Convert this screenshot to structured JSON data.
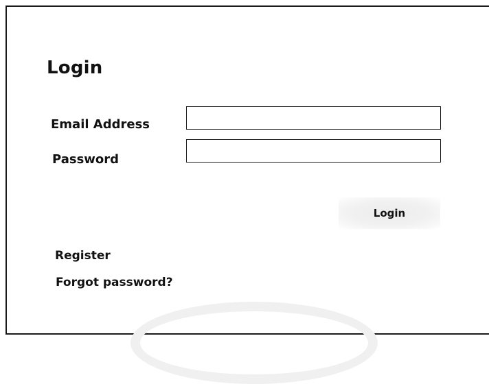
{
  "login_form": {
    "title": "Login",
    "email_label": "Email Address",
    "email_value": "",
    "password_label": "Password",
    "password_value": "",
    "submit_label": "Login"
  },
  "links": {
    "register": "Register",
    "forgot_password": "Forgot password?"
  }
}
